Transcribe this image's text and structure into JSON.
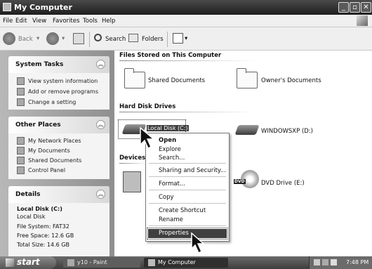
{
  "window": {
    "title": "My Computer"
  },
  "menubar": {
    "file": "File",
    "edit": "Edit",
    "view": "View",
    "favorites": "Favorites",
    "tools": "Tools",
    "help": "Help"
  },
  "toolbar": {
    "back": "Back",
    "search": "Search",
    "folders": "Folders"
  },
  "system_tasks": {
    "title": "System Tasks",
    "items": [
      "View system information",
      "Add or remove programs",
      "Change a setting"
    ]
  },
  "other_places": {
    "title": "Other Places",
    "items": [
      "My Network Places",
      "My Documents",
      "Shared Documents",
      "Control Panel"
    ]
  },
  "details": {
    "title": "Details",
    "name": "Local Disk (C:)",
    "kind": "Local Disk",
    "filesystem": "File System: FAT32",
    "free": "Free Space: 12.6 GB",
    "total": "Total Size: 14.6 GB"
  },
  "main": {
    "section_files": "Files Stored on This Computer",
    "shared_docs": "Shared Documents",
    "owners_docs": "Owner's Documents",
    "section_hdd": "Hard Disk Drives",
    "local_disk": "Local Disk (C:)",
    "windowsxp": "WINDOWSXP (D:)",
    "section_devices": "Devices w",
    "dvd_badge": "DVD",
    "dvd_drive": "DVD Drive (E:)"
  },
  "context_menu": {
    "open": "Open",
    "explore": "Explore",
    "search": "Search...",
    "sharing": "Sharing and Security...",
    "format": "Format...",
    "copy": "Copy",
    "create_shortcut": "Create Shortcut",
    "rename": "Rename",
    "properties": "Properties"
  },
  "taskbar": {
    "start": "start",
    "task1": "y10 - Paint",
    "task2": "My Computer",
    "clock": "7:48 PM"
  }
}
